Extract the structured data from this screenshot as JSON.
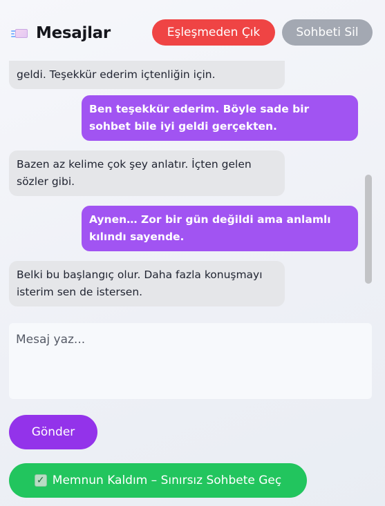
{
  "header": {
    "title": "Mesajlar",
    "icon": "envelope-sparkle-icon",
    "exit_match_label": "Eşleşmeden Çık",
    "delete_chat_label": "Sohbeti Sil"
  },
  "messages": [
    {
      "direction": "in",
      "text": "geldi. Teşekkür ederim içtenliğin için."
    },
    {
      "direction": "out",
      "text": "Ben teşekkür ederim. Böyle sade bir sohbet bile iyi geldi gerçekten."
    },
    {
      "direction": "in",
      "text": "Bazen az kelime çok şey anlatır. İçten gelen sözler gibi."
    },
    {
      "direction": "out",
      "text": "Aynen… Zor bir gün değildi ama anlamlı kılındı sayende."
    },
    {
      "direction": "in",
      "text": "Belki bu başlangıç olur. Daha fazla konuşmayı isterim sen de istersen."
    }
  ],
  "composer": {
    "placeholder": "Mesaj yaz...",
    "value": ""
  },
  "send_label": "Gönder",
  "upgrade_label": "Memnun Kaldım – Sınırsız Sohbete Geç",
  "colors": {
    "exit": "#ef4444",
    "delete": "#a3a8b2",
    "outgoing_bubble": "#a154f2",
    "incoming_bubble": "#e5e6e9",
    "send": "#9333ea",
    "upgrade": "#22c55e"
  }
}
